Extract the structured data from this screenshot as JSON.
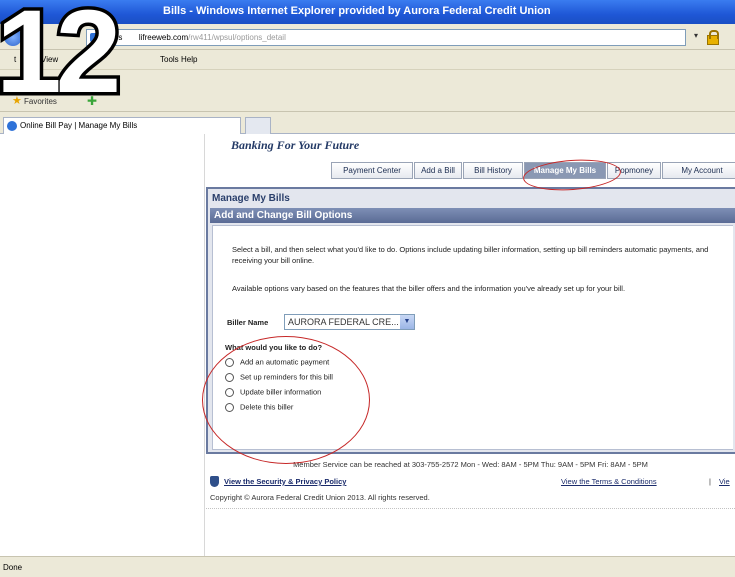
{
  "window": {
    "title": "Bills - Windows Internet Explorer provided by Aurora Federal Credit Union"
  },
  "address": {
    "url_start": "https",
    "url_host": "lifreeweb.com",
    "url_path": "/rw411/wpsul/options_detail"
  },
  "menu": [
    "t",
    "View",
    "Tools",
    "Help"
  ],
  "favorites": {
    "label": "Favorites"
  },
  "tab": {
    "label": "Online Bill Pay | Manage My Bills"
  },
  "status": "Done",
  "annotation": {
    "step_number": "12"
  },
  "site": {
    "tagline": "Banking For Your Future",
    "nav": [
      {
        "label": "Payment Center"
      },
      {
        "label": "Add a Bill"
      },
      {
        "label": "Bill History"
      },
      {
        "label": "Manage My Bills"
      },
      {
        "label": "Popmoney"
      },
      {
        "label": "My Account"
      }
    ],
    "page_title": "Manage My Bills",
    "section_title": "Add and Change Bill Options",
    "intro": "Select a bill, and then select what you'd like to do. Options include updating biller information, setting up bill reminders automatic payments, and receiving your bill online.",
    "availability": "Available options vary based on the features that the biller offers and the information you've already set up for your bill.",
    "biller_label": "Biller Name",
    "biller_value": "AURORA FEDERAL CRE...",
    "question": "What would you like to do?",
    "options": [
      "Add an automatic payment",
      "Set up reminders for this bill",
      "Update biller information",
      "Delete this biller"
    ],
    "member_service": "Member Service can be reached at 303-755-2572 Mon - Wed: 8AM - 5PM Thu: 9AM - 5PM Fri: 8AM - 5PM",
    "security_link": "View the Security & Privacy Policy",
    "terms_link": "View the Terms & Conditions",
    "terms_sep": "|",
    "terms_cut": "Vie",
    "copyright": "Copyright © Aurora Federal Credit Union 2013. All rights reserved."
  }
}
